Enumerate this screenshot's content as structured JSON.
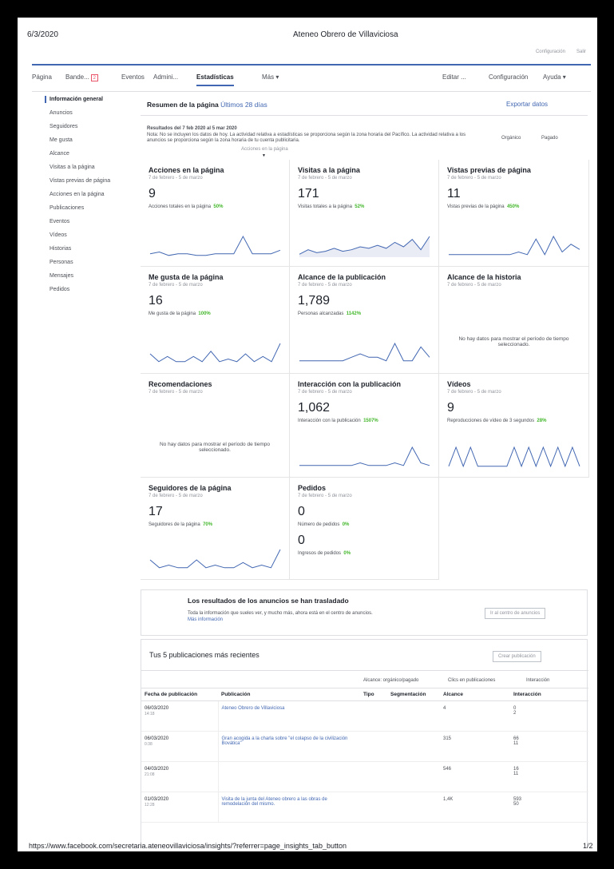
{
  "print_header": {
    "date": "6/3/2020",
    "title": "Ateneo Obrero de Villaviciosa"
  },
  "print_footer": {
    "url": "https://www.facebook.com/secretaria.ateneovillaviciosa/insights/?referrer=page_insights_tab_button",
    "page": "1/2"
  },
  "top_links": [
    "Configuración",
    "Salir"
  ],
  "nav": {
    "pagina": "Página",
    "bandeja": "Bande...",
    "bandeja_badge": "2",
    "eventos": "Eventos",
    "admin": "Admini...",
    "estadisticas": "Estadísticas",
    "mas": "Más ▾",
    "editar": "Editar ...",
    "configuracion": "Configuración",
    "ayuda": "Ayuda ▾"
  },
  "sidebar": [
    "Información general",
    "Anuncios",
    "Seguidores",
    "Me gusta",
    "Alcance",
    "Visitas a la página",
    "Vistas previas de página",
    "Acciones en la página",
    "Publicaciones",
    "Eventos",
    "Vídeos",
    "Historias",
    "Personas",
    "Mensajes",
    "Pedidos"
  ],
  "summary": {
    "title": "Resumen de la página",
    "range": "Últimos 28 días",
    "export": "Exportar datos",
    "results": "Resultados del 7 feb 2020 al 5 mar 2020",
    "note": "Nota: No se incluyen los datos de hoy. La actividad relativa a estadísticas se proporciona según la zona horaria del Pacífico. La actividad relativa a los anuncios se proporciona según la zona horaria de tu cuenta publicitaria.",
    "tooltip": "Acciones en la página",
    "organic": "Orgánico",
    "paid": "Pagado"
  },
  "cards": [
    {
      "title": "Acciones en la página",
      "sub": "7 de febrero - 5 de marzo",
      "num": "9",
      "metric": "Acciones totales en la página",
      "pct": "50%",
      "spark": [
        2,
        3,
        1,
        2,
        2,
        1,
        1,
        2,
        2,
        2,
        12,
        2,
        2,
        2,
        4
      ]
    },
    {
      "title": "Visitas a la página",
      "sub": "7 de febrero - 5 de marzo",
      "num": "171",
      "metric": "Visitas totales a la página",
      "pct": "52%",
      "spark": [
        2,
        5,
        3,
        4,
        6,
        4,
        5,
        7,
        6,
        8,
        6,
        10,
        7,
        12,
        5,
        14
      ]
    },
    {
      "title": "Vistas previas de página",
      "sub": "7 de febrero - 5 de marzo",
      "num": "11",
      "metric": "Vistas previas de la página",
      "pct": "450%",
      "spark": [
        1,
        1,
        1,
        1,
        1,
        1,
        1,
        1,
        2,
        1,
        7,
        1,
        8,
        2,
        5,
        3
      ]
    },
    {
      "title": "Me gusta de la página",
      "sub": "7 de febrero - 5 de marzo",
      "num": "16",
      "metric": "Me gusta de la página",
      "pct": "100%",
      "spark": [
        4,
        1,
        3,
        1,
        1,
        3,
        1,
        5,
        1,
        2,
        1,
        4,
        1,
        3,
        1,
        8
      ]
    },
    {
      "title": "Alcance de la publicación",
      "sub": "7 de febrero - 5 de marzo",
      "num": "1,789",
      "metric": "Personas alcanzadas",
      "pct": "1142%",
      "spark": [
        1,
        1,
        1,
        1,
        1,
        1,
        2,
        3,
        2,
        2,
        1,
        6,
        1,
        1,
        5,
        2
      ]
    },
    {
      "title": "Alcance de la historia",
      "sub": "7 de febrero - 5 de marzo",
      "empty": "No hay datos para mostrar el período de tiempo seleccionado."
    },
    {
      "title": "Recomendaciones",
      "sub": "7 de febrero - 5 de marzo",
      "empty": "No hay datos para mostrar el período de tiempo seleccionado."
    },
    {
      "title": "Interacción con la publicación",
      "sub": "7 de febrero - 5 de marzo",
      "num": "1,062",
      "metric": "Interacción con la publicación",
      "pct": "1507%",
      "spark": [
        1,
        1,
        1,
        1,
        1,
        1,
        1,
        2,
        1,
        1,
        1,
        2,
        1,
        8,
        2,
        1
      ]
    },
    {
      "title": "Vídeos",
      "sub": "7 de febrero - 5 de marzo",
      "num": "9",
      "metric": "Reproducciones de vídeo de 3 segundos",
      "pct": "28%",
      "spark": [
        1,
        12,
        1,
        12,
        1,
        1,
        1,
        1,
        1,
        12,
        1,
        12,
        1,
        12,
        1,
        12,
        1,
        12,
        1
      ]
    },
    {
      "title": "Seguidores de la página",
      "sub": "7 de febrero - 5 de marzo",
      "num": "17",
      "metric": "Seguidores de la página",
      "pct": "70%",
      "spark": [
        4,
        1,
        2,
        1,
        1,
        4,
        1,
        2,
        1,
        1,
        3,
        1,
        2,
        1,
        8
      ]
    },
    {
      "title": "Pedidos",
      "sub": "7 de febrero - 5 de marzo",
      "num": "0",
      "metric": "Número de pedidos",
      "pct": "0%",
      "num2": "0",
      "metric2": "Ingresos de pedidos",
      "pct2": "0%"
    }
  ],
  "ads": {
    "title": "Los resultados de los anuncios se han trasladado",
    "text": "Toda la información que sueles ver, y mucho más, ahora está en el centro de anuncios.",
    "link": "Más información",
    "button": "Ir al centro de anuncios"
  },
  "posts": {
    "title": "Tus 5 publicaciones más recientes",
    "create": "Crear publicación",
    "legend": [
      "Alcance: orgánico/pagado",
      "Clics en publicaciones",
      "Interacción"
    ],
    "headers": [
      "Fecha de publicación",
      "Publicación",
      "Tipo",
      "Segmentación",
      "Alcance",
      "Interacción"
    ],
    "rows": [
      {
        "date": "06/03/2020",
        "time": "14:18",
        "text": "Ateneo Obrero de Villaviciosa",
        "reach": "4",
        "i1": "0",
        "i2": "2"
      },
      {
        "date": "06/03/2020",
        "time": "0:38",
        "text": "Gran acogida a la charla sobre \"el colapso de la civilización Bovática\"",
        "reach": "315",
        "i1": "66",
        "i2": "11"
      },
      {
        "date": "04/03/2020",
        "time": "21:08",
        "text": "",
        "reach": "546",
        "i1": "16",
        "i2": "11"
      },
      {
        "date": "01/03/2020",
        "time": "12:28",
        "text": "Visita de la junta del Ateneo obrero a las obras de remodelación del mismo.",
        "reach": "1,4K",
        "i1": "593",
        "i2": "50"
      }
    ]
  }
}
